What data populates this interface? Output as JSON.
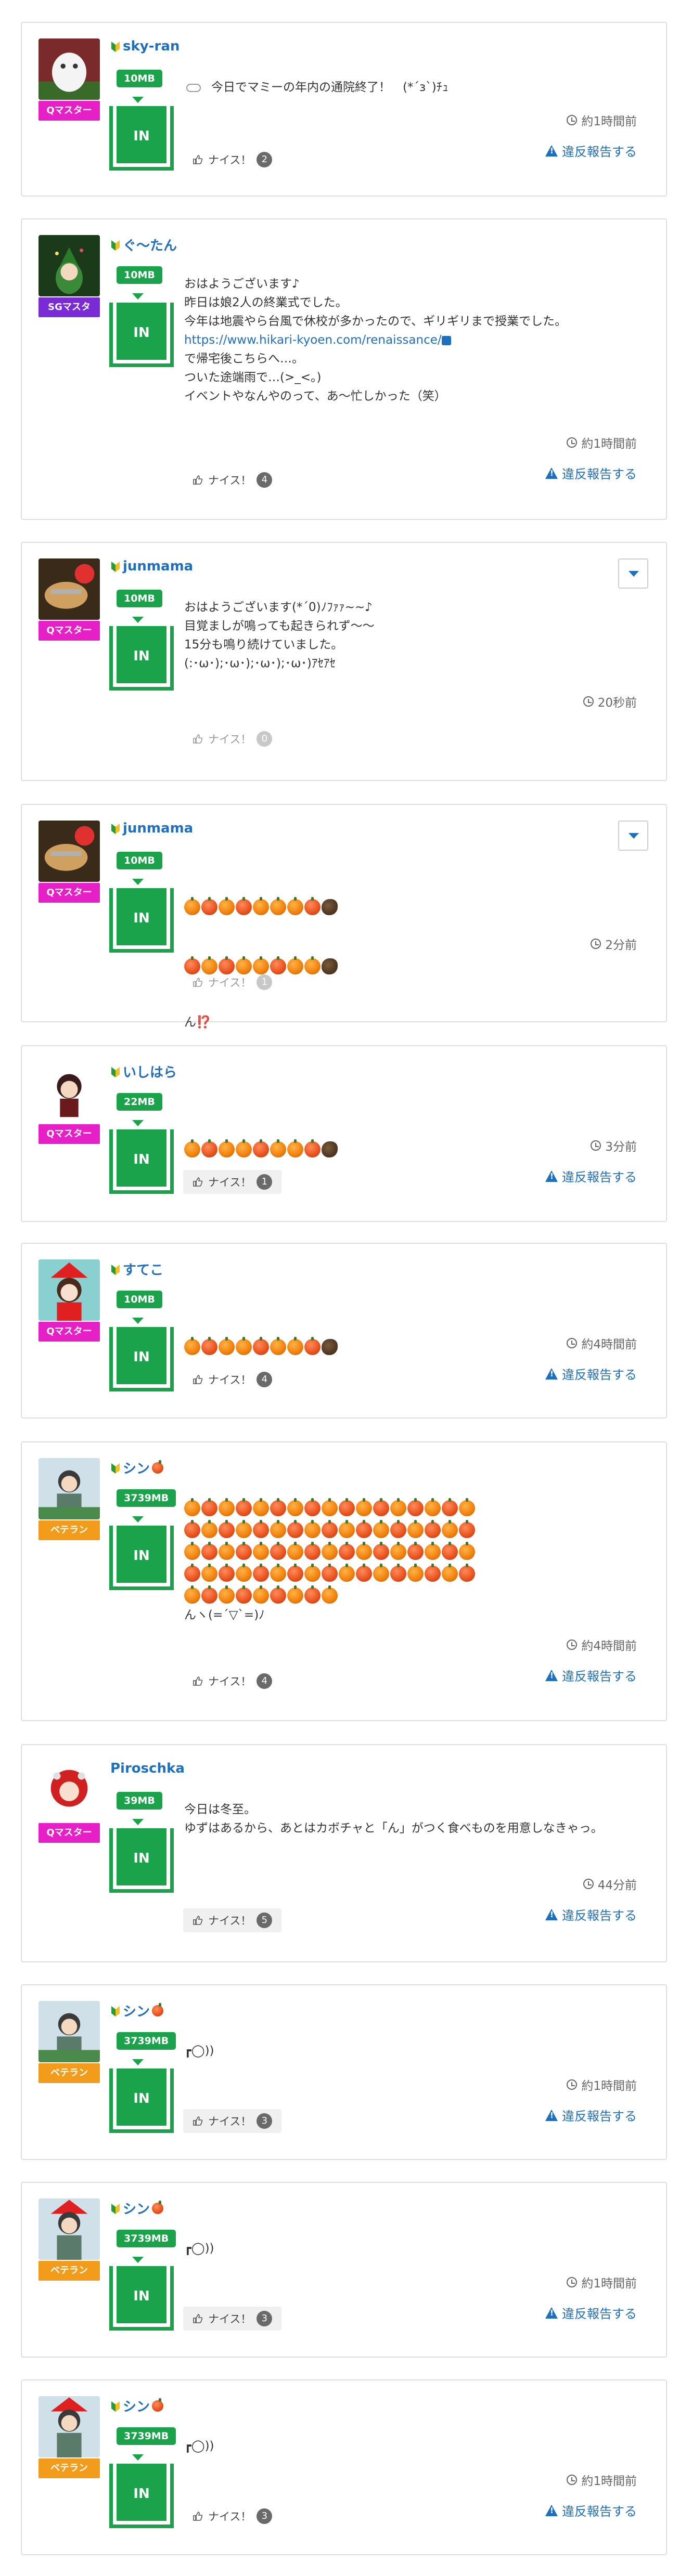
{
  "posts": [
    {
      "user": "sky-ran",
      "badge": "Qマスター",
      "mb": "10MB",
      "text": "今日でマミーの年内の通院終了！　(*´з`)ﾁｭ",
      "time": "約1時間前",
      "nice_label": "ナイス！",
      "nice_count": "2",
      "report": "違反報告する",
      "leaf": true
    },
    {
      "user": "ぐ〜たん",
      "badge": "SGマスタ",
      "mb": "10MB",
      "text_lines": [
        "おはようございます♪",
        "昨日は娘2人の終業式でした。",
        "今年は地震やら台風で休校が多かったので、ギリギリまで授業でした。"
      ],
      "link": "https://www.hikari-kyoen.com/renaissance/",
      "text_lines2": [
        "で帰宅後こちらへ…。",
        "ついた途端雨で…(&gt;_&lt;。)",
        "イベントやなんやのって、あ〜忙しかった（笑）"
      ],
      "time": "約1時間前",
      "nice_label": "ナイス！",
      "nice_count": "4",
      "report": "違反報告する",
      "leaf": true
    },
    {
      "user": "junmama",
      "badge": "Qマスター",
      "mb": "10MB",
      "text": "おはようございます(*´0)ﾉﾌｧｧ~~♪\n目覚ましが鳴っても起きられず〜〜\n15分も鳴り続けていました。\n(:･ω･);･ω･);･ω･);･ω･)ｱｾｱｾ",
      "time": "20秒前",
      "nice_label": "ナイス！",
      "nice_count": "0",
      "leaf": true
    },
    {
      "user": "junmama",
      "badge": "Qマスター",
      "mb": "10MB",
      "text_end": "ん⁉️",
      "time": "2分前",
      "nice_label": "ナイス！",
      "nice_count": "1",
      "leaf": true
    },
    {
      "user": "いしはら",
      "badge": "Qマスター",
      "mb": "22MB",
      "time": "3分前",
      "nice_label": "ナイス！",
      "nice_count": "1",
      "report": "違反報告する",
      "leaf": true
    },
    {
      "user": "すてこ",
      "badge": "Qマスター",
      "mb": "10MB",
      "time": "約4時間前",
      "nice_label": "ナイス！",
      "nice_count": "4",
      "report": "違反報告する",
      "leaf": true
    },
    {
      "user": "シン",
      "badge": "ベテラン",
      "mb": "3739MB",
      "text_end": "んヽ(=´▽`=)ﾉ",
      "time": "約4時間前",
      "nice_label": "ナイス！",
      "nice_count": "4",
      "report": "違反報告する",
      "leaf": true
    },
    {
      "user": "Piroschka",
      "badge": "Qマスター",
      "mb": "39MB",
      "text": "今日は冬至。\nゆずはあるから、あとはカボチャと「ん」がつく食べものを用意しなきゃっ。",
      "time": "44分前",
      "nice_label": "ナイス！",
      "nice_count": "5",
      "report": "違反報告する",
      "leaf": false
    },
    {
      "user": "シン",
      "badge": "ベテラン",
      "mb": "3739MB",
      "text": "┏◯))",
      "time": "約1時間前",
      "nice_label": "ナイス！",
      "nice_count": "3",
      "report": "違反報告する",
      "leaf": true
    },
    {
      "user": "シン",
      "badge": "ベテラン",
      "mb": "3739MB",
      "text": "┏◯))",
      "time": "約1時間前",
      "nice_label": "ナイス！",
      "nice_count": "3",
      "report": "違反報告する",
      "leaf": true
    },
    {
      "user": "シン",
      "badge": "ベテラン",
      "mb": "3739MB",
      "text": "┏◯))",
      "time": "約1時間前",
      "nice_label": "ナイス！",
      "nice_count": "3",
      "report": "違反報告する",
      "leaf": true
    }
  ],
  "common": {
    "in_label": "IN"
  },
  "colors": {
    "link": "#1f6fbf",
    "green": "#1aa34a",
    "qmaster": "#e61fc7",
    "sgmaster": "#7b2bd6",
    "veteran": "#f39b1b"
  },
  "icons": {
    "cloud": "cloud-icon",
    "clock": "clock-icon",
    "thumb": "thumbs-up-icon",
    "warn": "warning-icon",
    "leaf": "beginner-leaf-icon",
    "tangerine": "tangerine-icon",
    "hedgehog": "hedgehog-icon"
  }
}
